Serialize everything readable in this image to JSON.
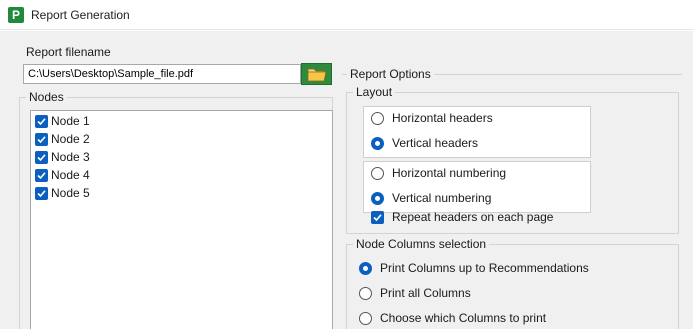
{
  "window": {
    "title": "Report Generation",
    "icon": "app-logo-icon",
    "icon_glyph": "P"
  },
  "filename": {
    "label": "Report filename",
    "value": "C:\\Users\\Desktop\\Sample_file.pdf",
    "browse_icon": "folder-open-icon"
  },
  "nodes": {
    "legend": "Nodes",
    "items": [
      {
        "label": "Node 1",
        "checked": true
      },
      {
        "label": "Node 2",
        "checked": true
      },
      {
        "label": "Node 3",
        "checked": true
      },
      {
        "label": "Node 4",
        "checked": true
      },
      {
        "label": "Node 5",
        "checked": true
      }
    ]
  },
  "report_options": {
    "legend": "Report Options",
    "layout": {
      "legend": "Layout",
      "headers": {
        "horizontal": {
          "label": "Horizontal headers",
          "selected": false
        },
        "vertical": {
          "label": "Vertical headers",
          "selected": true
        }
      },
      "numbering": {
        "horizontal": {
          "label": "Horizontal numbering",
          "selected": false
        },
        "vertical": {
          "label": "Vertical numbering",
          "selected": true
        }
      },
      "repeat_headers": {
        "label": "Repeat headers on each page",
        "checked": true
      }
    },
    "node_columns": {
      "legend": "Node Columns selection",
      "options": [
        {
          "label": "Print Columns up to Recommendations",
          "selected": true
        },
        {
          "label": "Print all Columns",
          "selected": false
        },
        {
          "label": "Choose which Columns to print",
          "selected": false
        }
      ]
    }
  },
  "colors": {
    "accent": "#0a5fbf",
    "brand_green": "#2e8b3e"
  }
}
